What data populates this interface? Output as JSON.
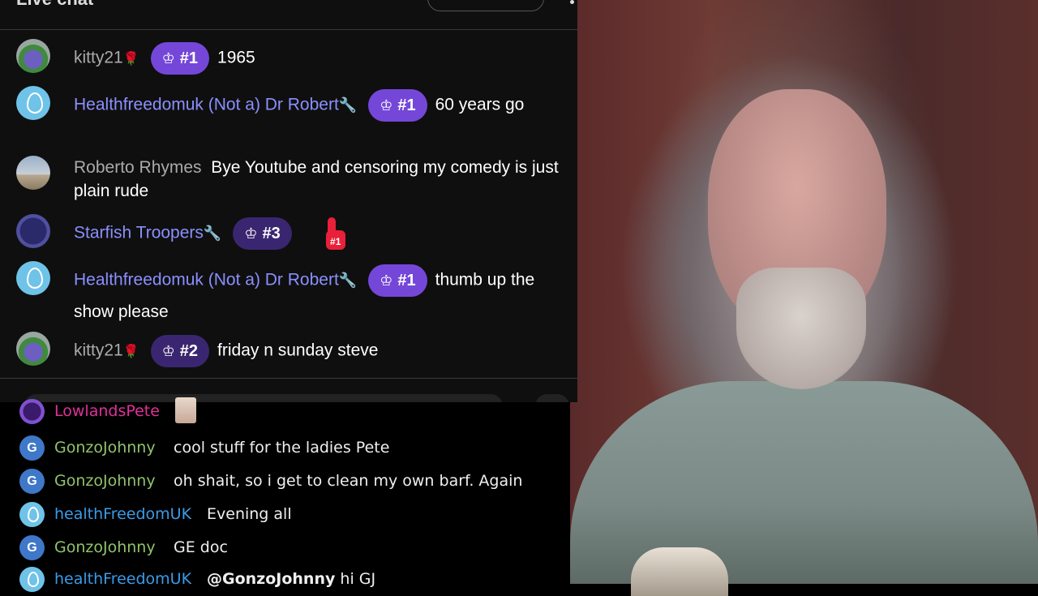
{
  "top_chat": {
    "title": "Live chat",
    "messages": [
      {
        "author": "kitty21",
        "rose": "🌹",
        "badge": "#1",
        "text": "1965"
      },
      {
        "author": "Healthfreedomuk (Not a) Dr Robert",
        "wrench": "🔧",
        "badge": "#1",
        "text": "60 years go"
      },
      {
        "author": "Roberto Rhymes",
        "text": "Bye Youtube and censoring my comedy is just plain rude"
      },
      {
        "author": "Starfish Troopers",
        "wrench": "🔧",
        "badge": "#3",
        "sticker": "#1"
      },
      {
        "author": "Healthfreedomuk (Not a) Dr Robert",
        "wrench": "🔧",
        "badge": "#1",
        "text": "thumb up the show please"
      },
      {
        "author": "kitty21",
        "rose": "🌹",
        "badge": "#2",
        "text": "friday n sunday steve"
      }
    ],
    "crown_icon": "♔"
  },
  "bottom_chat": {
    "messages": [
      {
        "author": "LowlandsPete",
        "text": ""
      },
      {
        "author": "GonzoJohnny",
        "avatar_letter": "G",
        "text": "cool stuff for the ladies Pete"
      },
      {
        "author": "GonzoJohnny",
        "avatar_letter": "G",
        "text": "oh shait, so i get to clean my own barf. Again"
      },
      {
        "author": "healthFreedomUK",
        "text": "Evening all"
      },
      {
        "author": "GonzoJohnny",
        "avatar_letter": "G",
        "text": "GE doc"
      },
      {
        "author": "healthFreedomUK",
        "mention": "@GonzoJohnny",
        "text": " hi GJ"
      }
    ]
  },
  "colors": {
    "yt_background": "#0f0f0f",
    "badge_purple": "#7447d8",
    "author_purple": "#8a8fff",
    "green_name": "#8fc46a",
    "blue_name": "#3b9be8",
    "pink_name": "#e0309a"
  }
}
